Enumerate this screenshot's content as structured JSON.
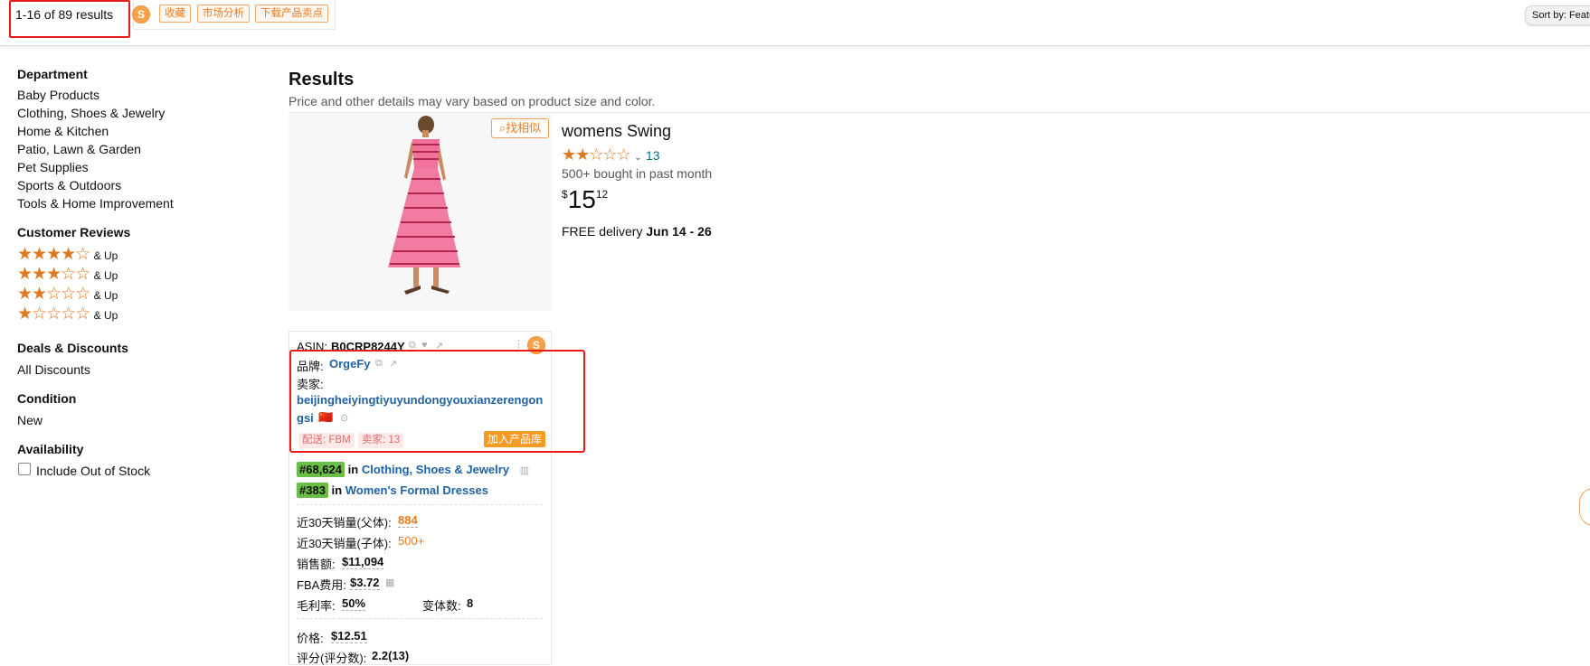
{
  "topbar": {
    "result_count": "1-16 of 89 results",
    "plugin_logo": "S",
    "tags": [
      "收藏",
      "市场分析",
      "下载产品卖点"
    ],
    "sort_label": "Sort by: Featured"
  },
  "sidebar": {
    "department_title": "Department",
    "departments": [
      "Baby Products",
      "Clothing, Shoes & Jewelry",
      "Home & Kitchen",
      "Patio, Lawn & Garden",
      "Pet Supplies",
      "Sports & Outdoors",
      "Tools & Home Improvement"
    ],
    "reviews_title": "Customer Reviews",
    "reviews": [
      {
        "stars": 4,
        "label": "& Up"
      },
      {
        "stars": 3,
        "label": "& Up"
      },
      {
        "stars": 2,
        "label": "& Up"
      },
      {
        "stars": 1,
        "label": "& Up"
      }
    ],
    "deals_title": "Deals & Discounts",
    "deals_item": "All Discounts",
    "condition_title": "Condition",
    "condition_item": "New",
    "availability_title": "Availability",
    "availability_item": "Include Out of Stock"
  },
  "results": {
    "title": "Results",
    "subtitle": "Price and other details may vary based on product size and color."
  },
  "product": {
    "find_similar": "找相似",
    "title": "womens Swing",
    "rating_stars": 2,
    "rating_count": "13",
    "bought": "500+ bought in past month",
    "price_symbol": "$",
    "price_whole": "15",
    "price_fraction": "12",
    "delivery_label": "FREE delivery",
    "delivery_dates": "Jun 14 - 26"
  },
  "panel": {
    "asin_label": "ASIN:",
    "asin_value": "B0CRP8244Y",
    "brand_label": "品牌:",
    "brand_value": "OrgeFy",
    "seller_label": "卖家:",
    "seller_value_line1": "beijingheiyingtiyuyundongyouxianzerengon",
    "seller_value_line2": "gsi",
    "flag": "🇨🇳",
    "ship_tag": "配送: FBM",
    "seller_count_tag": "卖家: 13",
    "add_to_library": "加入产品库",
    "rank1_badge": "#68,624",
    "rank1_in": "in",
    "rank1_category": "Clothing, Shoes & Jewelry",
    "rank2_badge": "#383",
    "rank2_in": "in",
    "rank2_category": "Women's Formal Dresses",
    "sales30_parent_label": "近30天销量(父体):",
    "sales30_parent_value": "884",
    "sales30_child_label": "近30天销量(子体):",
    "sales30_child_value": "500+",
    "revenue_label": "销售额:",
    "revenue_value": "$11,094",
    "fba_label": "FBA费用:",
    "fba_value": "$3.72",
    "margin_label": "毛利率:",
    "margin_value": "50%",
    "variants_label": "变体数:",
    "variants_value": "8",
    "price_label": "价格:",
    "price_value": "$12.51",
    "rating_label": "评分(评分数):",
    "rating_value": "2.2(13)"
  },
  "colors": {
    "accent_orange": "#f07b1c",
    "highlight_red": "#e41c1c",
    "link_blue": "#2162a1",
    "star_orange": "#de7921",
    "rank_green": "#6abd45"
  }
}
